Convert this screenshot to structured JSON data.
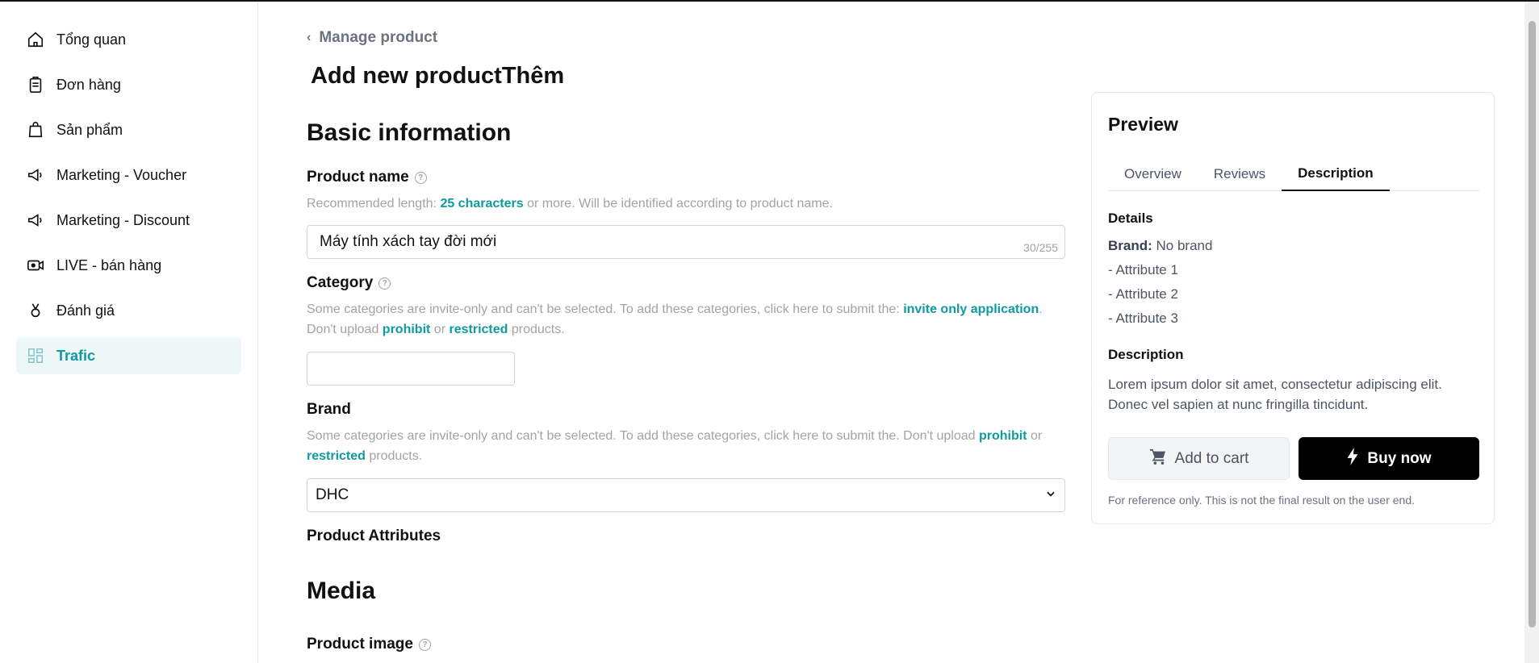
{
  "sidebar": {
    "items": [
      {
        "label": "Tổng quan",
        "icon": "home-icon"
      },
      {
        "label": "Đơn hàng",
        "icon": "clipboard-icon"
      },
      {
        "label": "Sản phẩm",
        "icon": "bag-icon"
      },
      {
        "label": "Marketing - Voucher",
        "icon": "megaphone-icon"
      },
      {
        "label": "Marketing - Discount",
        "icon": "megaphone-icon"
      },
      {
        "label": "LIVE - bán hàng",
        "icon": "live-video-icon"
      },
      {
        "label": "Đánh giá",
        "icon": "medal-icon"
      },
      {
        "label": "Trafic",
        "icon": "dashboard-grid-icon",
        "active": true
      }
    ]
  },
  "header": {
    "breadcrumb": "Manage product",
    "title": "Add new productThêm"
  },
  "basic": {
    "section_title": "Basic information",
    "product_name": {
      "label": "Product name",
      "hint_prefix": "Recommended length:",
      "hint_link": "25 characters",
      "hint_suffix": "or more. Will be identified according to product name.",
      "value": "Máy tính xách tay đời mới",
      "count": "30/255"
    },
    "category": {
      "label": "Category",
      "hint_prefix": "Some categories are invite-only and can't be selected. To add these categories, click here to submit the:",
      "hint_link1": "invite only application",
      "hint_mid1": ". Don't upload",
      "hint_link2": "prohibit",
      "hint_mid2": "or",
      "hint_link3": "restricted",
      "hint_suffix": "products.",
      "value": ""
    },
    "brand": {
      "label": "Brand",
      "hint_prefix": "Some categories are invite-only and can't be selected. To add these categories, click here to submit the. Don't upload",
      "hint_link1": "prohibit",
      "hint_mid": "or",
      "hint_link2": "restricted",
      "hint_suffix": "products.",
      "selected": "DHC"
    },
    "attributes_label": "Product Attributes"
  },
  "media": {
    "section_title": "Media",
    "image_label": "Product image"
  },
  "preview": {
    "title": "Preview",
    "tabs": [
      "Overview",
      "Reviews",
      "Description"
    ],
    "active_tab": "Description",
    "details_heading": "Details",
    "brand_key": "Brand:",
    "brand_value": "No brand",
    "attributes": [
      "- Attribute 1",
      "- Attribute 2",
      "- Attribute 3"
    ],
    "description_heading": "Description",
    "description_text": "Lorem ipsum dolor sit amet, consectetur adipiscing elit. Donec vel sapien at nunc fringilla tincidunt.",
    "add_to_cart": "Add to cart",
    "buy_now": "Buy now",
    "note": "For reference only. This is not the final result on the user end."
  },
  "colors": {
    "accent": "#0f9aa0",
    "active_bg": "#eef8f8",
    "buy_button": "#000000"
  }
}
